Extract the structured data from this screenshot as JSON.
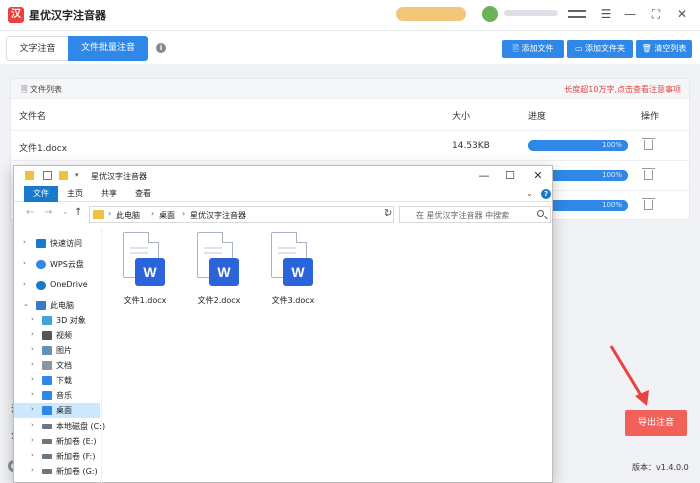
{
  "app": {
    "title": "星优汉字注音器",
    "logo_glyph": "汉",
    "window_controls": [
      "☰",
      "—",
      "⛶",
      "✕"
    ]
  },
  "tabs": {
    "text_tab": "文字注音",
    "batch_tab": "文件批量注音"
  },
  "toolbar": {
    "add_file": "🖹 添加文件",
    "add_folder": "▭ 添加文件夹",
    "clear_list": "🗑 清空列表"
  },
  "file_list": {
    "title": "🗏 文件列表",
    "warning": "长度超10万字,点击查看注意事项",
    "columns": {
      "name": "文件名",
      "size": "大小",
      "progress": "进度",
      "action": "操作"
    },
    "rows": [
      {
        "name": "文件1.docx",
        "size": "14.53KB",
        "progress_label": "100%",
        "progress": 100
      },
      {
        "name": "",
        "size": "",
        "progress_label": "100%",
        "progress": 100
      },
      {
        "name": "",
        "size": "",
        "progress_label": "100%",
        "progress": 100
      }
    ]
  },
  "background_labels": {
    "note": "注",
    "split": "分"
  },
  "export_button": "导出注音",
  "version": "版本：v1.4.0.0",
  "explorer": {
    "title": "星优汉字注音器",
    "ribbon": [
      "文件",
      "主页",
      "共享",
      "查看"
    ],
    "help": "?",
    "nav": {
      "back": "←",
      "forward": "→",
      "recent": "⌄",
      "up": "↑"
    },
    "breadcrumb": [
      "此电脑",
      "桌面",
      "星优汉字注音器"
    ],
    "search_placeholder": "在 星优汉字注音器 中搜索",
    "sidebar": [
      {
        "label": "快速访问",
        "icon": "star-icon",
        "color": "#1979ca"
      },
      {
        "label": "WPS云盘",
        "icon": "cloud-icon",
        "color": "#2f88e8"
      },
      {
        "label": "OneDrive",
        "icon": "onedrive-icon",
        "color": "#1979ca"
      },
      {
        "label": "此电脑",
        "icon": "computer-icon",
        "color": "#3c78c8"
      },
      {
        "label": "3D 对象",
        "icon": "cube-icon",
        "color": "#3fa4d6"
      },
      {
        "label": "视频",
        "icon": "video-icon",
        "color": "#555"
      },
      {
        "label": "图片",
        "icon": "picture-icon",
        "color": "#6a8fb5"
      },
      {
        "label": "文档",
        "icon": "document-icon",
        "color": "#8a95a3"
      },
      {
        "label": "下载",
        "icon": "download-icon",
        "color": "#2f88e8"
      },
      {
        "label": "音乐",
        "icon": "music-icon",
        "color": "#2f88e8"
      },
      {
        "label": "桌面",
        "icon": "desktop-icon",
        "color": "#2f88e8"
      },
      {
        "label": "本地磁盘 (C:)",
        "icon": "drive-icon",
        "color": "#6b7785"
      },
      {
        "label": "新加卷 (E:)",
        "icon": "drive-icon",
        "color": "#6b7785"
      },
      {
        "label": "新加卷 (F:)",
        "icon": "drive-icon",
        "color": "#6b7785"
      },
      {
        "label": "新加卷 (G:)",
        "icon": "drive-icon",
        "color": "#6b7785"
      }
    ],
    "files": [
      {
        "name": "文件1.docx",
        "badge": "W"
      },
      {
        "name": "文件2.docx",
        "badge": "W"
      },
      {
        "name": "文件3.docx",
        "badge": "W"
      }
    ]
  },
  "colors": {
    "accent": "#2f88e8",
    "export": "#f26159",
    "warning": "#e8433e",
    "word": "#2b63d9"
  }
}
